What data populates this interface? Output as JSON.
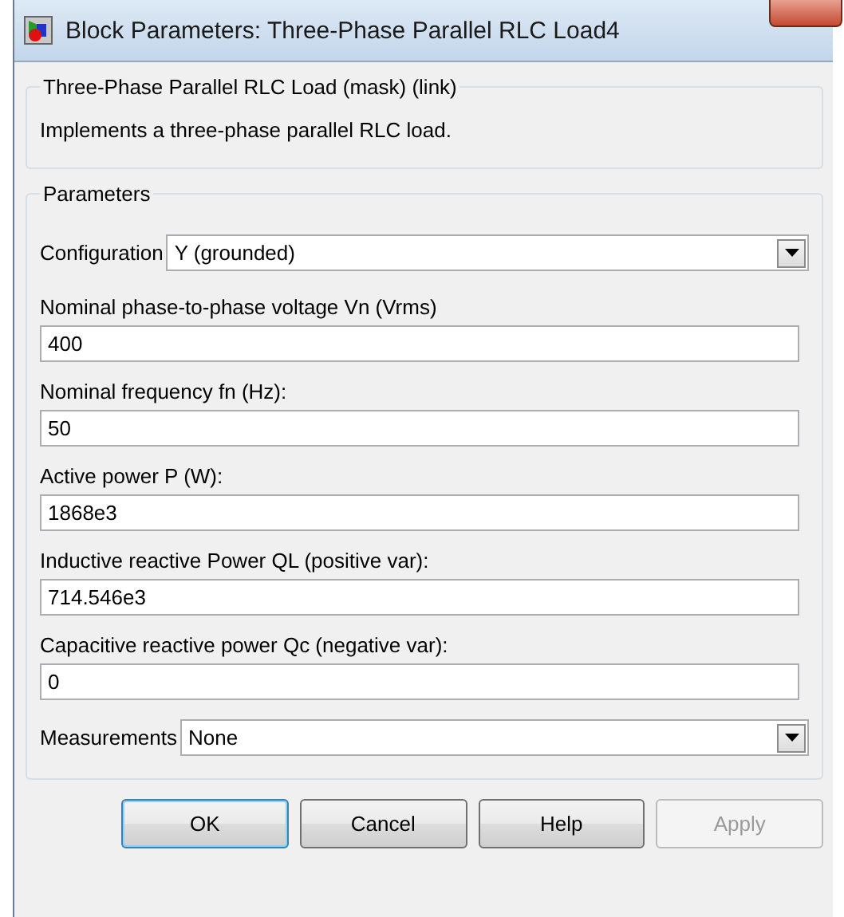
{
  "window": {
    "title": "Block Parameters: Three-Phase Parallel RLC Load4"
  },
  "description_group": {
    "title": "Three-Phase Parallel RLC Load (mask) (link)",
    "text": "Implements a three-phase parallel RLC load."
  },
  "parameters_group": {
    "title": "Parameters",
    "fields": [
      {
        "kind": "dropdown",
        "label": "Configuration",
        "value": "Y (grounded)"
      },
      {
        "kind": "text",
        "label": "Nominal phase-to-phase voltage Vn (Vrms)",
        "value": "400"
      },
      {
        "kind": "text",
        "label": "Nominal frequency fn (Hz):",
        "value": "50"
      },
      {
        "kind": "text",
        "label": "Active power P (W):",
        "value": "1868e3"
      },
      {
        "kind": "text",
        "label": "Inductive reactive Power QL (positive var):",
        "value": "714.546e3"
      },
      {
        "kind": "text",
        "label": "Capacitive reactive power Qc (negative var):",
        "value": "0"
      },
      {
        "kind": "dropdown",
        "label": "Measurements",
        "value": "None"
      }
    ]
  },
  "buttons": [
    {
      "label": "OK",
      "default": true,
      "disabled": false
    },
    {
      "label": "Cancel",
      "default": false,
      "disabled": false
    },
    {
      "label": "Help",
      "default": false,
      "disabled": false
    },
    {
      "label": "Apply",
      "default": false,
      "disabled": true
    }
  ]
}
